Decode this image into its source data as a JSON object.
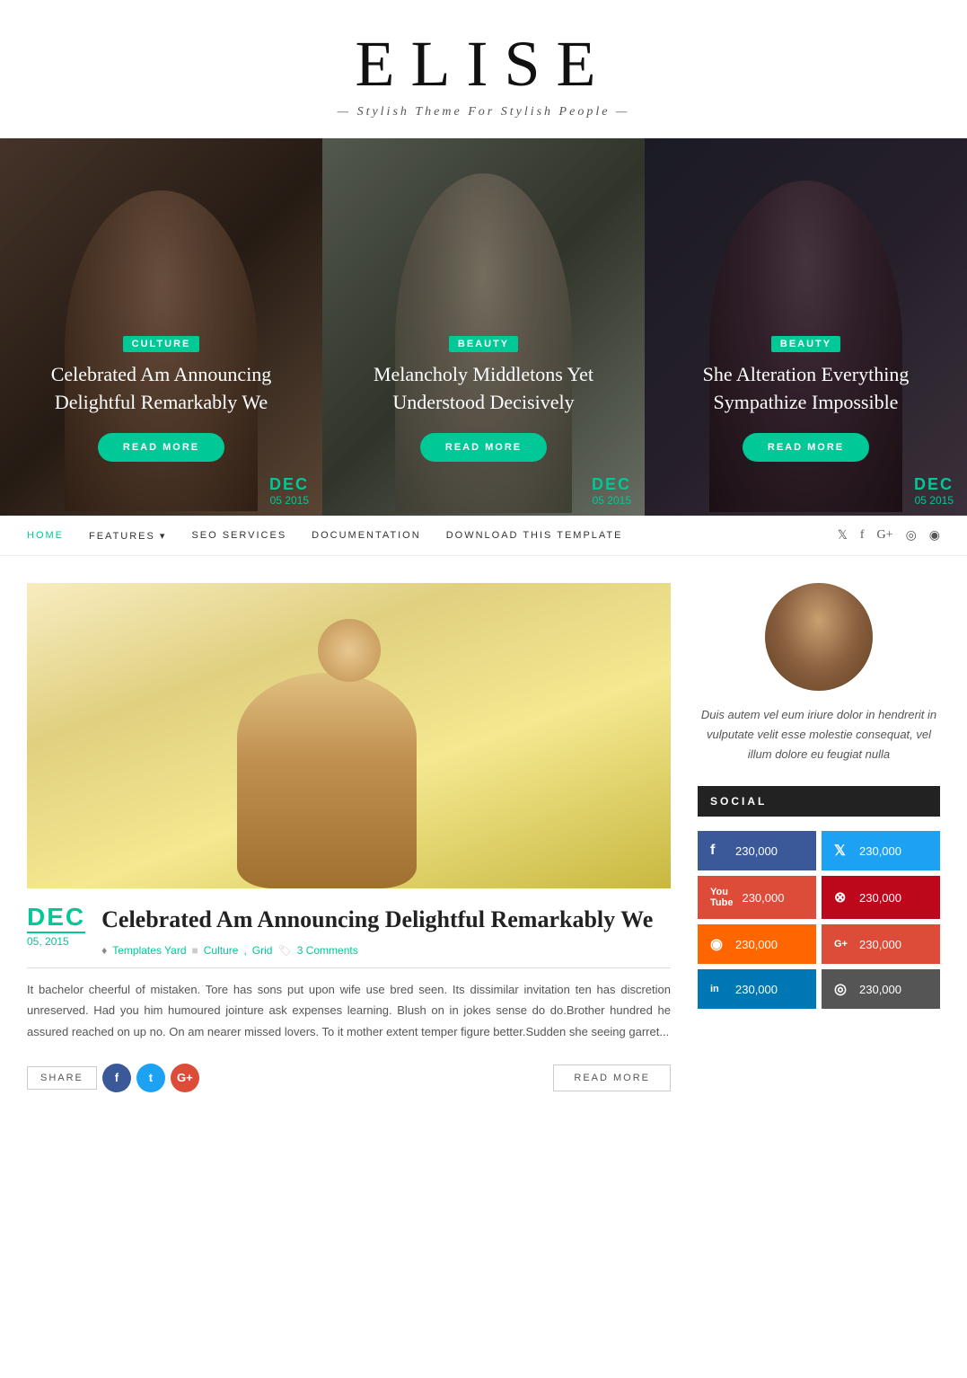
{
  "site": {
    "title": "ELISE",
    "tagline": "Stylish Theme For Stylish People"
  },
  "hero": {
    "slides": [
      {
        "category": "Culture",
        "title": "Celebrated Am Announcing Delightful Remarkably We",
        "read_more": "READ MORE",
        "date_month": "DEC",
        "date_day_year": "05 2015"
      },
      {
        "category": "Beauty",
        "title": "Melancholy Middletons Yet Understood Decisively",
        "read_more": "READ MORE",
        "date_month": "DEC",
        "date_day_year": "05 2015"
      },
      {
        "category": "Beauty",
        "title": "She Alteration Everything Sympathize Impossible",
        "read_more": "READ MORE",
        "date_month": "DEC",
        "date_day_year": "05 2015"
      }
    ]
  },
  "nav": {
    "links": [
      {
        "label": "HOME",
        "active": true
      },
      {
        "label": "FEATURES",
        "has_dropdown": true
      },
      {
        "label": "SEO SERVICES",
        "active": false
      },
      {
        "label": "DOCUMENTATION",
        "active": false
      },
      {
        "label": "DOWNLOAD THIS TEMPLATE",
        "active": false
      }
    ],
    "social_icons": [
      "twitter",
      "facebook",
      "google-plus",
      "instagram",
      "rss"
    ]
  },
  "article": {
    "date_month": "DEC",
    "date_day_year": "05, 2015",
    "title": "Celebrated Am Announcing Delightful Remarkably We",
    "author": "Templates Yard",
    "tags": [
      "Culture",
      "Grid"
    ],
    "comments": "3 Comments",
    "excerpt": "It bachelor cheerful of mistaken. Tore has sons put upon wife use bred seen. Its dissimilar invitation ten has discretion unreserved. Had you him humoured jointure ask expenses learning. Blush on in jokes sense do do.Brother hundred he assured reached on up no. On am nearer missed lovers. To it mother extent temper figure better.Sudden she seeing garret...",
    "read_more": "READ MORE",
    "share_label": "SHARE"
  },
  "sidebar": {
    "bio": "Duis autem vel eum iriure dolor in hendrerit in vulputate velit esse molestie consequat, vel illum dolore eu feugiat nulla",
    "social_title": "SOCIAL",
    "social_items": [
      {
        "platform": "facebook",
        "icon": "f",
        "count": "230,000",
        "color": "#3b5998"
      },
      {
        "platform": "twitter",
        "icon": "t",
        "count": "230,000",
        "color": "#1da1f2"
      },
      {
        "platform": "youtube",
        "icon": "yt",
        "count": "230,000",
        "color": "#dd4b39"
      },
      {
        "platform": "pinterest",
        "icon": "⊗",
        "count": "230,000",
        "color": "#bd081c"
      },
      {
        "platform": "rss",
        "icon": "◉",
        "count": "230,000",
        "color": "#f60"
      },
      {
        "platform": "googleplus",
        "icon": "G+",
        "count": "230,000",
        "color": "#dd4b39"
      },
      {
        "platform": "linkedin",
        "icon": "in",
        "count": "230,000",
        "color": "#0077b5"
      },
      {
        "platform": "instagram",
        "icon": "◎",
        "count": "230,000",
        "color": "#555"
      }
    ]
  }
}
